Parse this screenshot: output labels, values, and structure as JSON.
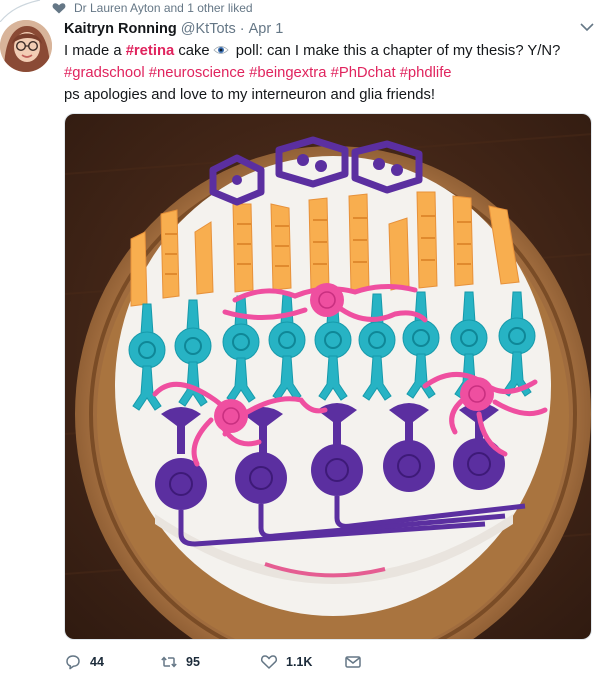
{
  "social_context": {
    "text": "Dr Lauren Ayton and 1 other liked"
  },
  "tweet": {
    "display_name": "Kaitryn Ronning",
    "handle": "@KtTots",
    "separator": "·",
    "date": "Apr 1",
    "text": {
      "line1_a": "I made a ",
      "line1_tag": "#retina",
      "line1_b": " cake",
      "line1_c": " poll: can I make this a chapter of my thesis? Y/N?",
      "hashtags": [
        "#gradschool",
        "#neuroscience",
        "#beingextra",
        "#PhDchat",
        "#phdlife"
      ],
      "line3": "ps apologies and love to my interneuron and glia friends!"
    },
    "actions": {
      "reply_count": "44",
      "retweet_count": "95",
      "like_count": "1.1K"
    }
  },
  "icons": {
    "social_context": "heart-icon",
    "reply": "reply-icon",
    "retweet": "retweet-icon",
    "like": "like-icon",
    "message": "envelope-icon",
    "menu": "caret-down-icon",
    "emoji": "eye-icon"
  },
  "colors": {
    "hashtag": "#e0245e",
    "secondary_text": "#657786",
    "name_text": "#14171a",
    "frosting": "#f4f2ee",
    "board": "#9a6a3c",
    "cone_orange": "#f8ae4f",
    "bipolar_teal": "#27b3c4",
    "ganglion_purple": "#5b2fa0",
    "horizontal_pink": "#ef4fa0"
  }
}
